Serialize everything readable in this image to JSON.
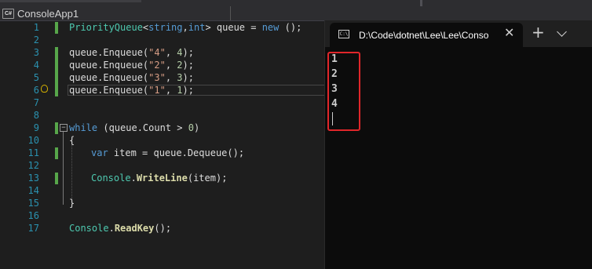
{
  "editor": {
    "project_name": "ConsoleApp1",
    "project_icon_text": "C#",
    "line_numbers": [
      "1",
      "2",
      "3",
      "4",
      "5",
      "6",
      "7",
      "8",
      "9",
      "10",
      "11",
      "12",
      "13",
      "14",
      "15",
      "16",
      "17"
    ]
  },
  "code": {
    "l1": {
      "type": "PriorityQueue",
      "gen1": "string",
      "gen2": "int",
      "var": "queue",
      "eq": " = ",
      "kw_new": "new",
      "end": " ();"
    },
    "l3": {
      "prefix": "queue.Enqueue(",
      "str": "\"4\"",
      "sep": ", ",
      "num": "4",
      "end": ");"
    },
    "l4": {
      "prefix": "queue.Enqueue(",
      "str": "\"2\"",
      "sep": ", ",
      "num": "2",
      "end": ");"
    },
    "l5": {
      "prefix": "queue.Enqueue(",
      "str": "\"3\"",
      "sep": ", ",
      "num": "3",
      "end": ");"
    },
    "l6": {
      "prefix": "queue.Enqueue(",
      "str": "\"1\"",
      "sep": ", ",
      "num": "1",
      "end": ");"
    },
    "l9": {
      "kw": "while",
      "rest": " (queue.Count > ",
      "num": "0",
      "end": ")"
    },
    "l10": {
      "text": "{"
    },
    "l11": {
      "kw": "var",
      "rest": " item = queue.Dequeue();"
    },
    "l13": {
      "cls": "Console",
      "dot": ".",
      "method": "WriteLine",
      "rest": "(item);"
    },
    "l16": {
      "text": "}"
    },
    "l17": {
      "cls": "Console",
      "dot": ".",
      "method": "ReadKey",
      "rest": "();"
    }
  },
  "terminal": {
    "tab_title": "D:\\Code\\dotnet\\Lee\\Lee\\Conso",
    "tab_icon_text": "C:\\",
    "close_glyph": "✕",
    "new_tab_glyph": "+",
    "output": [
      "1",
      "2",
      "3",
      "4"
    ],
    "highlight_color": "#e0262a"
  }
}
